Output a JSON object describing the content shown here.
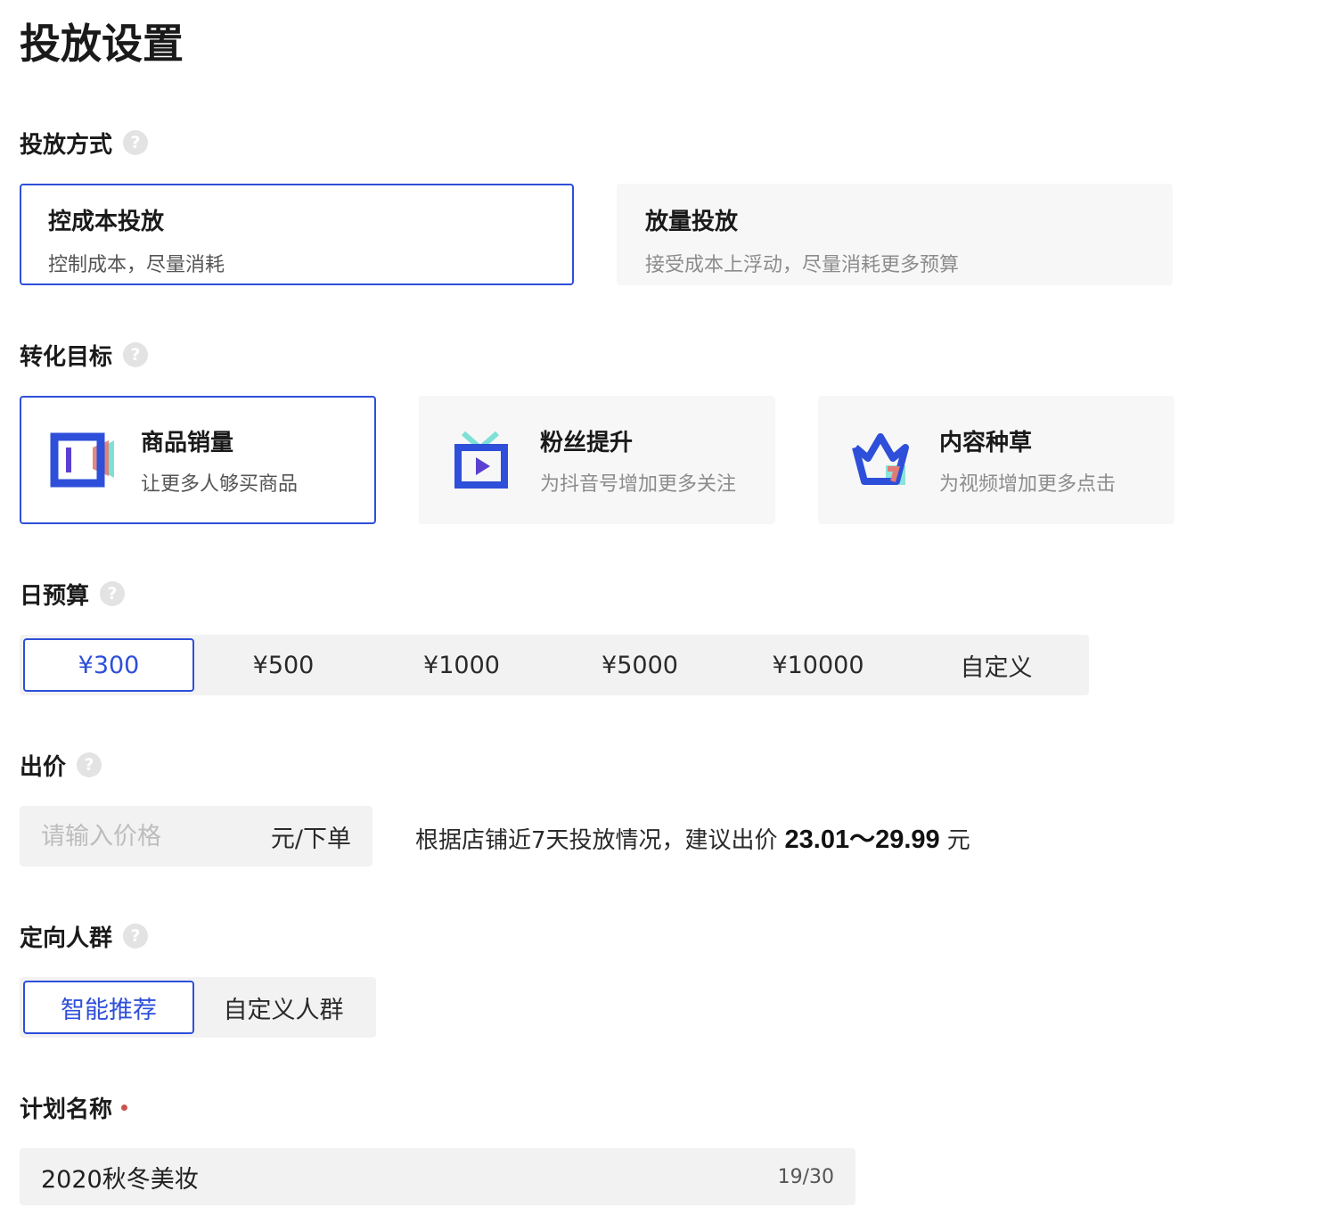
{
  "page": {
    "title": "投放设置"
  },
  "delivery_mode": {
    "label": "投放方式",
    "help": "?",
    "options": [
      {
        "title": "控成本投放",
        "desc": "控制成本，尽量消耗",
        "selected": true
      },
      {
        "title": "放量投放",
        "desc": "接受成本上浮动，尽量消耗更多预算",
        "selected": false
      }
    ]
  },
  "conversion_goal": {
    "label": "转化目标",
    "help": "?",
    "options": [
      {
        "title": "商品销量",
        "desc": "让更多人够买商品",
        "icon": "product-sales-icon",
        "selected": true
      },
      {
        "title": "粉丝提升",
        "desc": "为抖音号增加更多关注",
        "icon": "fans-tv-icon",
        "selected": false
      },
      {
        "title": "内容种草",
        "desc": "为视频增加更多点击",
        "icon": "crown-icon",
        "selected": false
      }
    ]
  },
  "daily_budget": {
    "label": "日预算",
    "help": "?",
    "options": [
      "¥300",
      "¥500",
      "¥1000",
      "¥5000",
      "¥10000",
      "自定义"
    ],
    "selected": "¥300"
  },
  "bid": {
    "label": "出价",
    "help": "?",
    "placeholder": "请输入价格",
    "value": "",
    "unit": "元/下单",
    "suggestion_prefix": "根据店铺近7天投放情况，建议出价",
    "suggestion_range": "23.01～29.99",
    "suggestion_suffix": "元"
  },
  "audience": {
    "label": "定向人群",
    "help": "?",
    "options": [
      "智能推荐",
      "自定义人群"
    ],
    "selected": "智能推荐"
  },
  "plan_name": {
    "label": "计划名称",
    "required": true,
    "value": "2020秋冬美妆",
    "counter": "19/30"
  },
  "colors": {
    "accent": "#2e4fd9",
    "teal": "#7ee0d6",
    "salmon": "#e27b74",
    "required": "#c9544d"
  }
}
